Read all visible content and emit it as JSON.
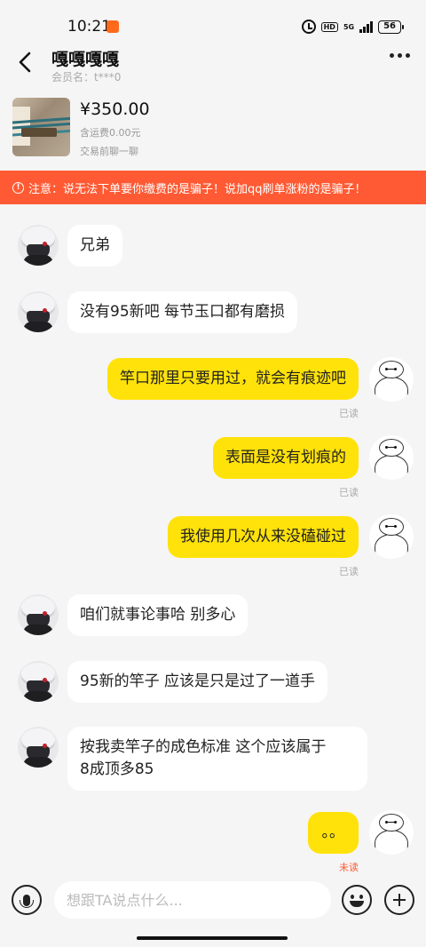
{
  "status_bar": {
    "time": "10:21",
    "network": "5G",
    "battery": "56"
  },
  "header": {
    "peer_name": "嘎嘎嘎嘎",
    "member_name": "会员名：t***0"
  },
  "product": {
    "price": "¥350.00",
    "shipping": "含运费0.00元",
    "note": "交易前聊一聊"
  },
  "warning": {
    "text": "注意：说无法下单要你缴费的是骗子！说加qq刷单涨粉的是骗子！",
    "color": "#ff5a33"
  },
  "messages": [
    {
      "side": "left",
      "text": "兄弟"
    },
    {
      "side": "left",
      "text": "没有95新吧 每节玉口都有磨损"
    },
    {
      "side": "right",
      "text": "竿口那里只要用过，就会有痕迹吧",
      "status": "已读"
    },
    {
      "side": "right",
      "text": "表面是没有划痕的",
      "status": "已读"
    },
    {
      "side": "right",
      "text": "我使用几次从来没磕碰过",
      "status": "已读"
    },
    {
      "side": "left",
      "text": "咱们就事论事哈 别多心"
    },
    {
      "side": "left",
      "text": "95新的竿子 应该是只是过了一道手"
    },
    {
      "side": "left",
      "text_line1": "按我卖竿子的成色标准 这个应该属于",
      "text_line2": "8成顶多85"
    },
    {
      "side": "right",
      "text": "。。",
      "status": "未读"
    }
  ],
  "input_bar": {
    "placeholder": "想跟TA说点什么..."
  },
  "colors": {
    "accent_yellow": "#ffe20a",
    "warning_orange": "#ff5a33",
    "background": "#f5f5f5"
  }
}
